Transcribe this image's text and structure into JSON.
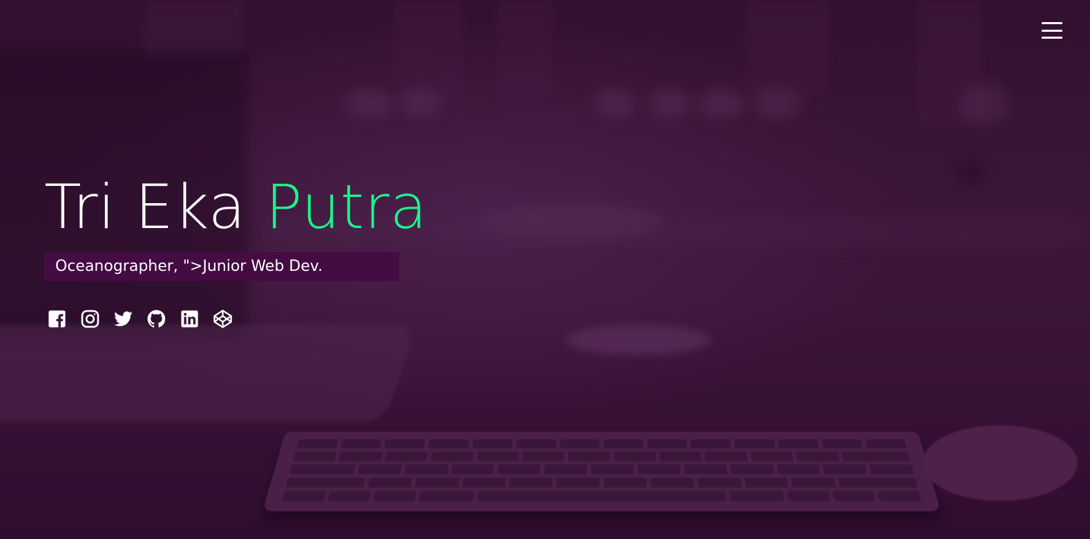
{
  "hero": {
    "name_first": "Tri Eka",
    "name_accent": "Putra",
    "subtitle": "Oceanographer, \">Junior Web Dev.",
    "accent_color": "#19f58a",
    "overlay_color": "#3a1238"
  },
  "header": {
    "menu_icon": "hamburger-menu-icon"
  },
  "social": [
    {
      "name": "facebook",
      "icon": "facebook-icon"
    },
    {
      "name": "instagram",
      "icon": "instagram-icon"
    },
    {
      "name": "twitter",
      "icon": "twitter-icon"
    },
    {
      "name": "github",
      "icon": "github-icon"
    },
    {
      "name": "linkedin",
      "icon": "linkedin-icon"
    },
    {
      "name": "codepen",
      "icon": "codepen-icon"
    }
  ]
}
